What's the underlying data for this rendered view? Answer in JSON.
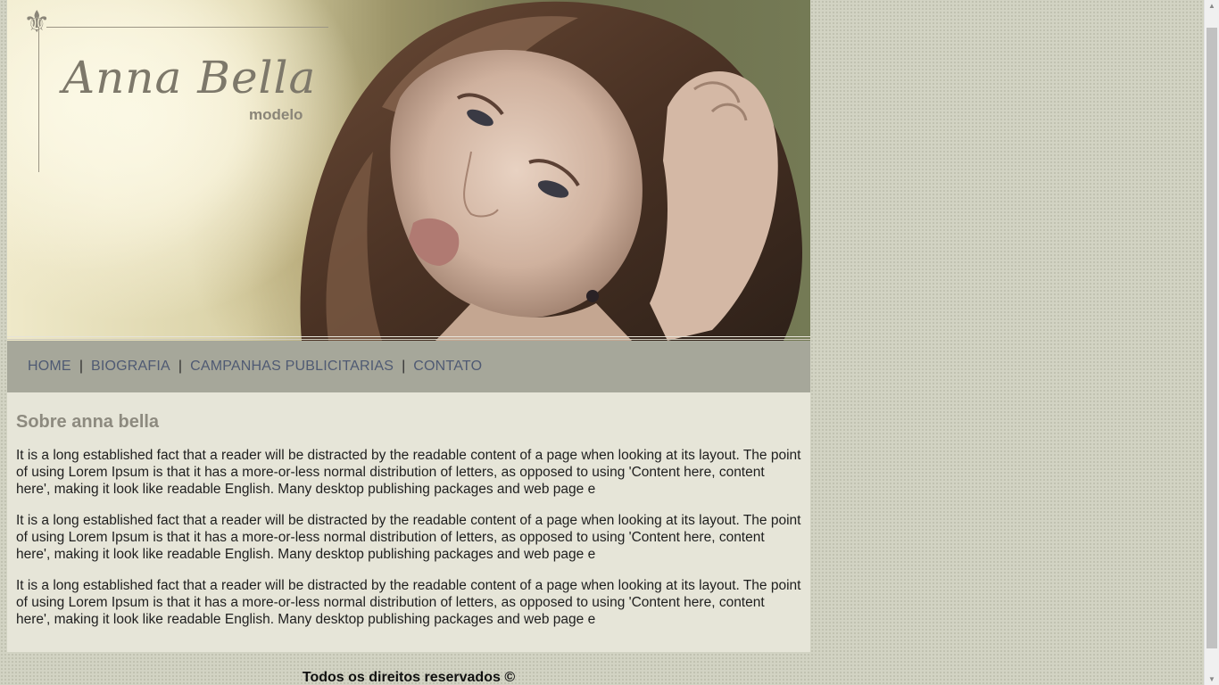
{
  "brand": {
    "name": "Anna Bella",
    "subtitle": "modelo",
    "emblem_icon": "fleur-de-lis-icon"
  },
  "nav": {
    "items": [
      {
        "label": "HOME"
      },
      {
        "label": "BIOGRAFIA"
      },
      {
        "label": "CAMPANHAS PUBLICITARIAS"
      },
      {
        "label": "CONTATO"
      }
    ],
    "separator": "|"
  },
  "main": {
    "heading": "Sobre anna bella",
    "paragraphs": [
      "It is a long established fact that a reader will be distracted by the readable content of a page when looking at its layout. The point of using Lorem Ipsum is that it has a more-or-less normal distribution of letters, as opposed to using 'Content here, content here', making it look like readable English. Many desktop publishing packages and web page e",
      "It is a long established fact that a reader will be distracted by the readable content of a page when looking at its layout. The point of using Lorem Ipsum is that it has a more-or-less normal distribution of letters, as opposed to using 'Content here, content here', making it look like readable English. Many desktop publishing packages and web page e",
      "It is a long established fact that a reader will be distracted by the readable content of a page when looking at its layout. The point of using Lorem Ipsum is that it has a more-or-less normal distribution of letters, as opposed to using 'Content here, content here', making it look like readable English. Many desktop publishing packages and web page e"
    ]
  },
  "footer": {
    "text": "Todos os direitos reservados ©"
  },
  "colors": {
    "nav_bg": "#a6a79a",
    "nav_link": "#4f5a73",
    "content_bg": "#e6e5d8",
    "heading": "#8d8a7f",
    "page_bg": "#d2d3c3"
  }
}
